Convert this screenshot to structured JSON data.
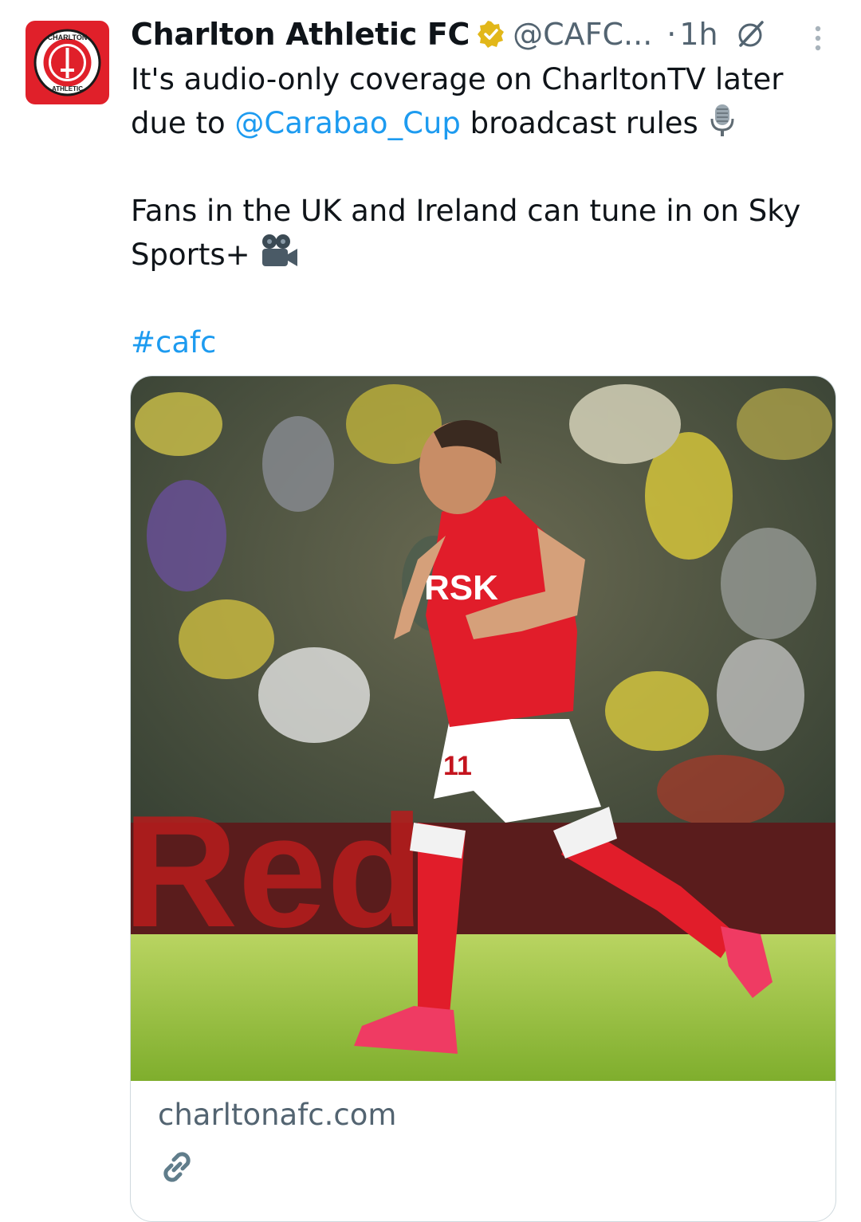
{
  "tweet": {
    "author": {
      "name": "Charlton Athletic FC",
      "handle": "@CAFC...",
      "verified_icon": "verified-badge-gold",
      "avatar_text_top": "CHARLTON",
      "avatar_text_bottom": "ATHLETIC"
    },
    "time_separator": "·",
    "time": "1h",
    "lines": {
      "l1": "It's audio-only coverage on CharltonTV later",
      "l2_prefix": "due to ",
      "l2_mention": "@Carabao_Cup",
      "l2_suffix": " broadcast rules ",
      "l3": "Fans in the UK and Ireland can tune in on Sky",
      "l4": "Sports+ ",
      "hashtag": "#cafc"
    },
    "emojis": [
      "microphone-emoji",
      "movie-camera-emoji"
    ],
    "card": {
      "domain": "charltonafc.com",
      "photo_text": "Red",
      "sponsor": "RSK",
      "shirt_number": "11",
      "link_icon": "link-icon"
    }
  },
  "colors": {
    "link": "#1d9bf0",
    "secondary_text": "#536471",
    "brand_red": "#e0202a",
    "verified_gold": "#e2b719"
  }
}
